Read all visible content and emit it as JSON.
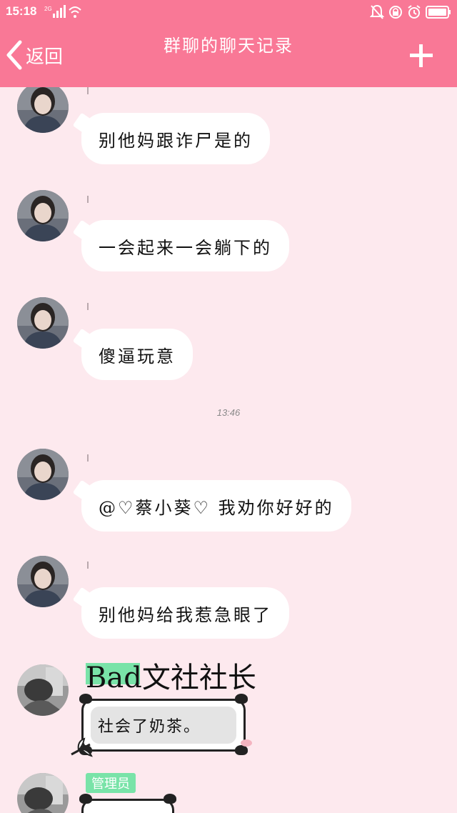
{
  "status_bar": {
    "time": "15:18",
    "network": "2G",
    "battery_color": "#ffffff"
  },
  "header": {
    "back_label": "返回",
    "title": "群聊的聊天记录",
    "add_icon": "plus-icon",
    "background": "#f97896"
  },
  "chat": {
    "messages": [
      {
        "text": "别他妈跟诈尸是的"
      },
      {
        "text": "一会起来一会躺下的"
      },
      {
        "text": "傻逼玩意"
      },
      {
        "text": "@♡蔡小葵♡ 我劝你好好的"
      },
      {
        "text": "别他妈给我惹急眼了"
      }
    ],
    "timestamp": "13:46",
    "special_sender": {
      "title_tag": "Bad文社社长",
      "message": "社会了奶茶。"
    },
    "admin_badge": "管理员"
  }
}
